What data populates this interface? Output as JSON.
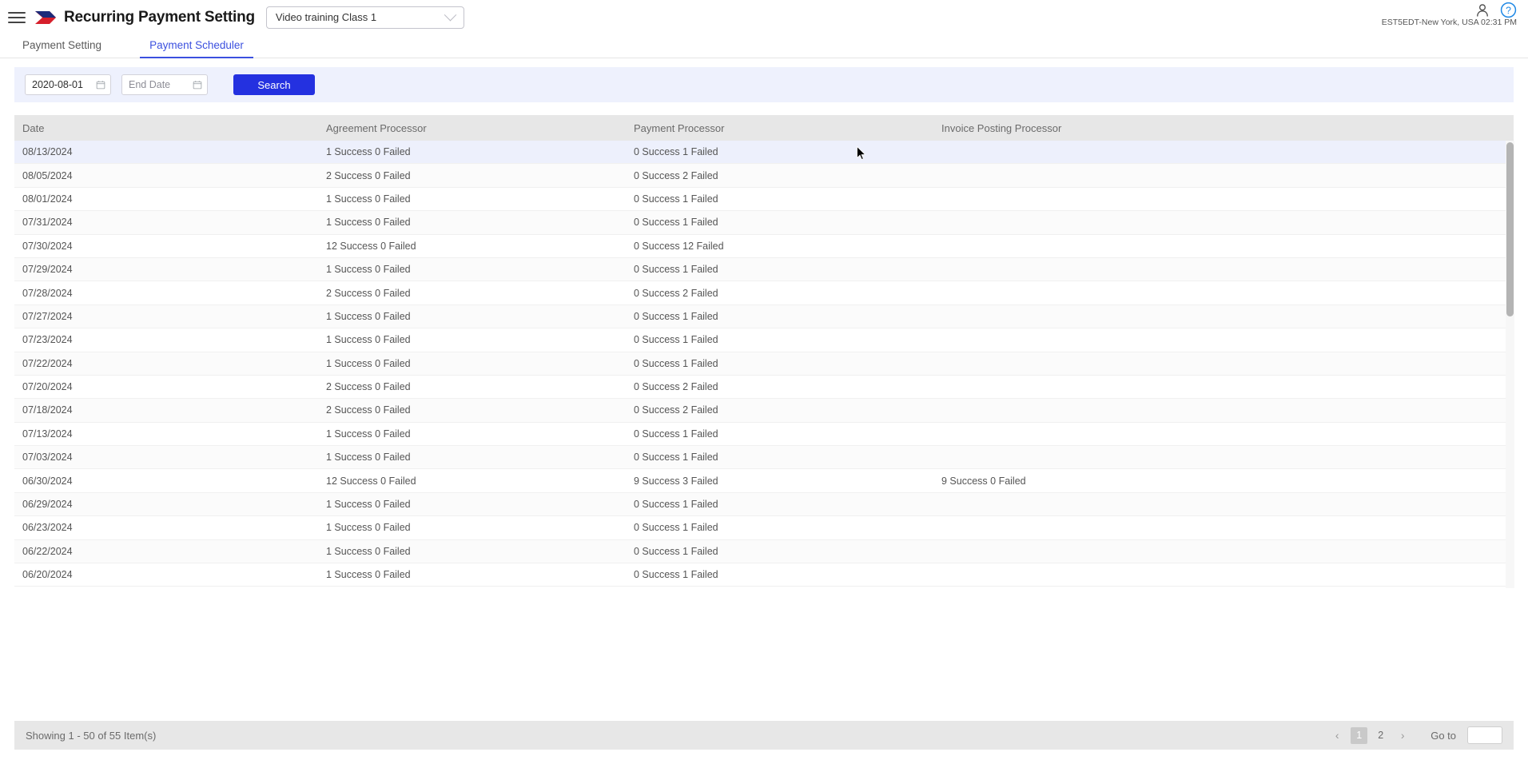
{
  "header": {
    "menu_icon": "hamburger-menu-icon",
    "logo_icon": "brand-logo-icon",
    "title": "Recurring Payment Setting",
    "class_selector": {
      "value": "Video training Class 1",
      "chevron": "chevron-down-icon"
    },
    "user_icon": "user-account-icon",
    "help_icon": "help-circle-icon",
    "timezone": "EST5EDT-New York, USA 02:31 PM"
  },
  "tabs": [
    {
      "label": "Payment Setting",
      "active": false
    },
    {
      "label": "Payment Scheduler",
      "active": true
    }
  ],
  "filters": {
    "start_date": {
      "value": "2020-08-01",
      "placeholder": "Start Date"
    },
    "end_date": {
      "value": "",
      "placeholder": "End Date"
    },
    "search_label": "Search",
    "calendar_icon": "calendar-icon"
  },
  "table": {
    "columns": [
      "Date",
      "Agreement Processor",
      "Payment Processor",
      "Invoice Posting Processor"
    ],
    "rows": [
      {
        "date": "08/13/2024",
        "agreement": "1 Success 0 Failed",
        "payment": "0 Success 1 Failed",
        "invoice": ""
      },
      {
        "date": "08/05/2024",
        "agreement": "2 Success 0 Failed",
        "payment": "0 Success 2 Failed",
        "invoice": ""
      },
      {
        "date": "08/01/2024",
        "agreement": "1 Success 0 Failed",
        "payment": "0 Success 1 Failed",
        "invoice": ""
      },
      {
        "date": "07/31/2024",
        "agreement": "1 Success 0 Failed",
        "payment": "0 Success 1 Failed",
        "invoice": ""
      },
      {
        "date": "07/30/2024",
        "agreement": "12 Success 0 Failed",
        "payment": "0 Success 12 Failed",
        "invoice": ""
      },
      {
        "date": "07/29/2024",
        "agreement": "1 Success 0 Failed",
        "payment": "0 Success 1 Failed",
        "invoice": ""
      },
      {
        "date": "07/28/2024",
        "agreement": "2 Success 0 Failed",
        "payment": "0 Success 2 Failed",
        "invoice": ""
      },
      {
        "date": "07/27/2024",
        "agreement": "1 Success 0 Failed",
        "payment": "0 Success 1 Failed",
        "invoice": ""
      },
      {
        "date": "07/23/2024",
        "agreement": "1 Success 0 Failed",
        "payment": "0 Success 1 Failed",
        "invoice": ""
      },
      {
        "date": "07/22/2024",
        "agreement": "1 Success 0 Failed",
        "payment": "0 Success 1 Failed",
        "invoice": ""
      },
      {
        "date": "07/20/2024",
        "agreement": "2 Success 0 Failed",
        "payment": "0 Success 2 Failed",
        "invoice": ""
      },
      {
        "date": "07/18/2024",
        "agreement": "2 Success 0 Failed",
        "payment": "0 Success 2 Failed",
        "invoice": ""
      },
      {
        "date": "07/13/2024",
        "agreement": "1 Success 0 Failed",
        "payment": "0 Success 1 Failed",
        "invoice": ""
      },
      {
        "date": "07/03/2024",
        "agreement": "1 Success 0 Failed",
        "payment": "0 Success 1 Failed",
        "invoice": ""
      },
      {
        "date": "06/30/2024",
        "agreement": "12 Success 0 Failed",
        "payment": "9 Success 3 Failed",
        "invoice": "9 Success 0 Failed"
      },
      {
        "date": "06/29/2024",
        "agreement": "1 Success 0 Failed",
        "payment": "0 Success 1 Failed",
        "invoice": ""
      },
      {
        "date": "06/23/2024",
        "agreement": "1 Success 0 Failed",
        "payment": "0 Success 1 Failed",
        "invoice": ""
      },
      {
        "date": "06/22/2024",
        "agreement": "1 Success 0 Failed",
        "payment": "0 Success 1 Failed",
        "invoice": ""
      },
      {
        "date": "06/20/2024",
        "agreement": "1 Success 0 Failed",
        "payment": "0 Success 1 Failed",
        "invoice": ""
      }
    ],
    "highlighted_row_index": 0
  },
  "footer": {
    "showing": "Showing 1 - 50 of 55 Item(s)",
    "prev_icon": "chevron-left-icon",
    "next_icon": "chevron-right-icon",
    "pages": [
      "1",
      "2"
    ],
    "active_page": "1",
    "goto_label": "Go to",
    "goto_value": ""
  },
  "colors": {
    "accent": "#2431e0",
    "tab_active": "#3b50df",
    "filter_bg": "#eef1fd",
    "header_bg": "#e7e7e7",
    "row_highlight": "#edf0fc"
  }
}
